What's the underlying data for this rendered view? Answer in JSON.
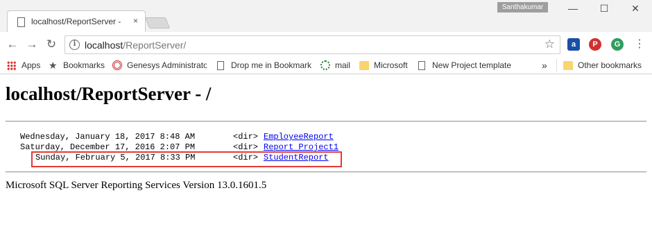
{
  "browser": {
    "tab_title": "localhost/ReportServer -",
    "tab_close": "×",
    "user_name": "Santhakumar",
    "window_controls": {
      "minimize": "—",
      "maximize": "☐",
      "close": "✕"
    }
  },
  "toolbar": {
    "back": "←",
    "forward": "→",
    "reload": "↻",
    "info": "i",
    "url_host": "localhost",
    "url_path": "/ReportServer/",
    "bookmark_star": "☆",
    "extensions": [
      {
        "name": "account-extension-icon",
        "glyph": "a",
        "color": "#1a4fa3"
      },
      {
        "name": "pinterest-icon",
        "glyph": "P",
        "color": "#d32f2f"
      },
      {
        "name": "grammarly-icon",
        "glyph": "G",
        "color": "#2e9e5e"
      }
    ],
    "menu": "⋮"
  },
  "bookmarks": {
    "items": [
      {
        "label": "Apps",
        "icon": "apps-grid-icon"
      },
      {
        "label": "Bookmarks",
        "icon": "star-icon"
      },
      {
        "label": "Genesys Administrato",
        "icon": "genesys-icon"
      },
      {
        "label": "Drop me in Bookmark",
        "icon": "page-icon"
      },
      {
        "label": "mail",
        "icon": "mail-icon"
      },
      {
        "label": "Microsoft",
        "icon": "folder-icon"
      },
      {
        "label": "New Project template",
        "icon": "page-icon"
      }
    ],
    "overflow": "»",
    "other": "Other bookmarks"
  },
  "page": {
    "title": "localhost/ReportServer - /",
    "entries": [
      {
        "date": "Wednesday, January 18, 2017 8:48 AM",
        "type": "<dir>",
        "name": "EmployeeReport"
      },
      {
        "date": "Saturday, December 17, 2016 2:07 PM",
        "type": "<dir>",
        "name": "Report Project1"
      },
      {
        "date": "Sunday, February 5, 2017 8:33 PM",
        "type": "<dir>",
        "name": "StudentReport"
      }
    ],
    "footer": "Microsoft SQL Server Reporting Services Version 13.0.1601.5"
  },
  "colors": {
    "link": "#0000ee",
    "highlight_box": "#e53935"
  }
}
